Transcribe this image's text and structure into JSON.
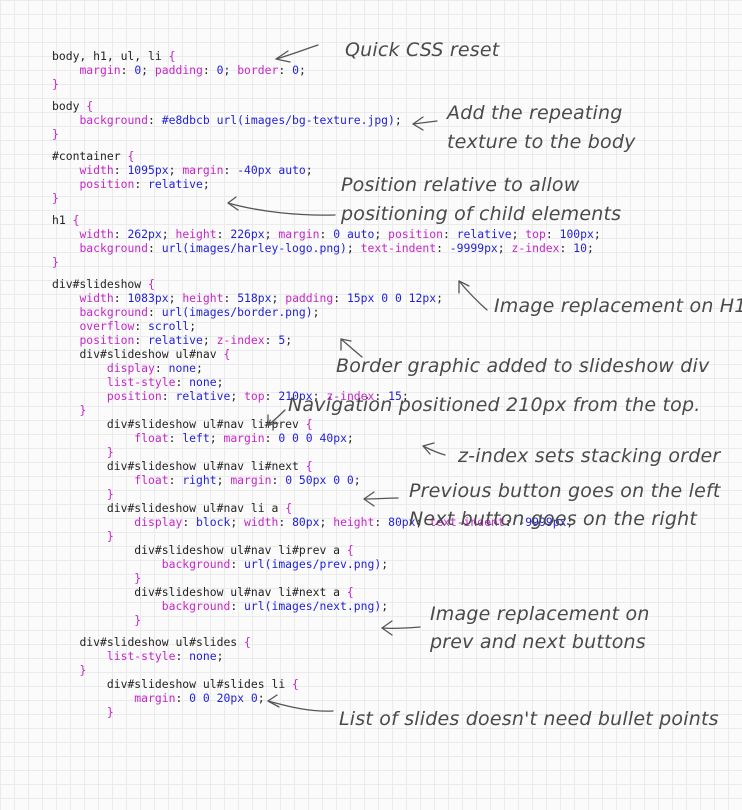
{
  "code_lines": [
    [
      [
        "sel",
        "body, h1, ul, li "
      ],
      [
        "brace",
        "{"
      ]
    ],
    [
      [
        "ind",
        "    "
      ],
      [
        "prop",
        "margin"
      ],
      [
        "sel",
        ": "
      ],
      [
        "val",
        "0"
      ],
      [
        "sel",
        "; "
      ],
      [
        "prop",
        "padding"
      ],
      [
        "sel",
        ": "
      ],
      [
        "val",
        "0"
      ],
      [
        "sel",
        "; "
      ],
      [
        "prop",
        "border"
      ],
      [
        "sel",
        ": "
      ],
      [
        "val",
        "0"
      ],
      [
        "sel",
        ";"
      ]
    ],
    [
      [
        "brace",
        "}"
      ]
    ],
    [],
    [
      [
        "sel",
        "body "
      ],
      [
        "brace",
        "{"
      ]
    ],
    [
      [
        "ind",
        "    "
      ],
      [
        "prop",
        "background"
      ],
      [
        "sel",
        ": "
      ],
      [
        "val",
        "#e8dbcb url(images/bg-texture.jpg)"
      ],
      [
        "sel",
        ";"
      ]
    ],
    [
      [
        "brace",
        "}"
      ]
    ],
    [],
    [
      [
        "sel",
        "#container "
      ],
      [
        "brace",
        "{"
      ]
    ],
    [
      [
        "ind",
        "    "
      ],
      [
        "prop",
        "width"
      ],
      [
        "sel",
        ": "
      ],
      [
        "val",
        "1095px"
      ],
      [
        "sel",
        "; "
      ],
      [
        "prop",
        "margin"
      ],
      [
        "sel",
        ": "
      ],
      [
        "val",
        "-40px auto"
      ],
      [
        "sel",
        ";"
      ]
    ],
    [
      [
        "ind",
        "    "
      ],
      [
        "prop",
        "position"
      ],
      [
        "sel",
        ": "
      ],
      [
        "val",
        "relative"
      ],
      [
        "sel",
        ";"
      ]
    ],
    [
      [
        "brace",
        "}"
      ]
    ],
    [],
    [
      [
        "sel",
        "h1 "
      ],
      [
        "brace",
        "{"
      ]
    ],
    [
      [
        "ind",
        "    "
      ],
      [
        "prop",
        "width"
      ],
      [
        "sel",
        ": "
      ],
      [
        "val",
        "262px"
      ],
      [
        "sel",
        "; "
      ],
      [
        "prop",
        "height"
      ],
      [
        "sel",
        ": "
      ],
      [
        "val",
        "226px"
      ],
      [
        "sel",
        "; "
      ],
      [
        "prop",
        "margin"
      ],
      [
        "sel",
        ": "
      ],
      [
        "val",
        "0 auto"
      ],
      [
        "sel",
        "; "
      ],
      [
        "prop",
        "position"
      ],
      [
        "sel",
        ": "
      ],
      [
        "val",
        "relative"
      ],
      [
        "sel",
        "; "
      ],
      [
        "prop",
        "top"
      ],
      [
        "sel",
        ": "
      ],
      [
        "val",
        "100px"
      ],
      [
        "sel",
        ";"
      ]
    ],
    [
      [
        "ind",
        "    "
      ],
      [
        "prop",
        "background"
      ],
      [
        "sel",
        ": "
      ],
      [
        "val",
        "url(images/harley-logo.png)"
      ],
      [
        "sel",
        "; "
      ],
      [
        "prop",
        "text-indent"
      ],
      [
        "sel",
        ": "
      ],
      [
        "val",
        "-9999px"
      ],
      [
        "sel",
        "; "
      ],
      [
        "prop",
        "z-index"
      ],
      [
        "sel",
        ": "
      ],
      [
        "val",
        "10"
      ],
      [
        "sel",
        ";"
      ]
    ],
    [
      [
        "brace",
        "}"
      ]
    ],
    [],
    [
      [
        "sel",
        "div#slideshow "
      ],
      [
        "brace",
        "{"
      ]
    ],
    [
      [
        "ind",
        "    "
      ],
      [
        "prop",
        "width"
      ],
      [
        "sel",
        ": "
      ],
      [
        "val",
        "1083px"
      ],
      [
        "sel",
        "; "
      ],
      [
        "prop",
        "height"
      ],
      [
        "sel",
        ": "
      ],
      [
        "val",
        "518px"
      ],
      [
        "sel",
        "; "
      ],
      [
        "prop",
        "padding"
      ],
      [
        "sel",
        ": "
      ],
      [
        "val",
        "15px 0 0 12px"
      ],
      [
        "sel",
        ";"
      ]
    ],
    [
      [
        "ind",
        "    "
      ],
      [
        "prop",
        "background"
      ],
      [
        "sel",
        ": "
      ],
      [
        "val",
        "url(images/border.png)"
      ],
      [
        "sel",
        ";"
      ]
    ],
    [
      [
        "ind",
        "    "
      ],
      [
        "prop",
        "overflow"
      ],
      [
        "sel",
        ": "
      ],
      [
        "val",
        "scroll"
      ],
      [
        "sel",
        ";"
      ]
    ],
    [
      [
        "ind",
        "    "
      ],
      [
        "prop",
        "position"
      ],
      [
        "sel",
        ": "
      ],
      [
        "val",
        "relative"
      ],
      [
        "sel",
        "; "
      ],
      [
        "prop",
        "z-index"
      ],
      [
        "sel",
        ": "
      ],
      [
        "val",
        "5"
      ],
      [
        "sel",
        ";"
      ]
    ],
    [
      [
        "ind",
        "    "
      ],
      [
        "sel",
        "div#slideshow ul#nav "
      ],
      [
        "brace",
        "{"
      ]
    ],
    [
      [
        "ind",
        "        "
      ],
      [
        "prop",
        "display"
      ],
      [
        "sel",
        ": "
      ],
      [
        "val",
        "none"
      ],
      [
        "sel",
        ";"
      ]
    ],
    [
      [
        "ind",
        "        "
      ],
      [
        "prop",
        "list-style"
      ],
      [
        "sel",
        ": "
      ],
      [
        "val",
        "none"
      ],
      [
        "sel",
        ";"
      ]
    ],
    [
      [
        "ind",
        "        "
      ],
      [
        "prop",
        "position"
      ],
      [
        "sel",
        ": "
      ],
      [
        "val",
        "relative"
      ],
      [
        "sel",
        "; "
      ],
      [
        "prop",
        "top"
      ],
      [
        "sel",
        ": "
      ],
      [
        "val",
        "210px"
      ],
      [
        "sel",
        "; "
      ],
      [
        "prop",
        "z-index"
      ],
      [
        "sel",
        ": "
      ],
      [
        "val",
        "15"
      ],
      [
        "sel",
        ";"
      ]
    ],
    [
      [
        "ind",
        "    "
      ],
      [
        "brace",
        "}"
      ]
    ],
    [
      [
        "ind",
        "        "
      ],
      [
        "sel",
        "div#slideshow ul#nav li#prev "
      ],
      [
        "brace",
        "{"
      ]
    ],
    [
      [
        "ind",
        "            "
      ],
      [
        "prop",
        "float"
      ],
      [
        "sel",
        ": "
      ],
      [
        "val",
        "left"
      ],
      [
        "sel",
        "; "
      ],
      [
        "prop",
        "margin"
      ],
      [
        "sel",
        ": "
      ],
      [
        "val",
        "0 0 0 40px"
      ],
      [
        "sel",
        ";"
      ]
    ],
    [
      [
        "ind",
        "        "
      ],
      [
        "brace",
        "}"
      ]
    ],
    [
      [
        "ind",
        "        "
      ],
      [
        "sel",
        "div#slideshow ul#nav li#next "
      ],
      [
        "brace",
        "{"
      ]
    ],
    [
      [
        "ind",
        "            "
      ],
      [
        "prop",
        "float"
      ],
      [
        "sel",
        ": "
      ],
      [
        "val",
        "right"
      ],
      [
        "sel",
        "; "
      ],
      [
        "prop",
        "margin"
      ],
      [
        "sel",
        ": "
      ],
      [
        "val",
        "0 50px 0 0"
      ],
      [
        "sel",
        ";"
      ]
    ],
    [
      [
        "ind",
        "        "
      ],
      [
        "brace",
        "}"
      ]
    ],
    [
      [
        "ind",
        "        "
      ],
      [
        "sel",
        "div#slideshow ul#nav li a "
      ],
      [
        "brace",
        "{"
      ]
    ],
    [
      [
        "ind",
        "            "
      ],
      [
        "prop",
        "display"
      ],
      [
        "sel",
        ": "
      ],
      [
        "val",
        "block"
      ],
      [
        "sel",
        "; "
      ],
      [
        "prop",
        "width"
      ],
      [
        "sel",
        ": "
      ],
      [
        "val",
        "80px"
      ],
      [
        "sel",
        "; "
      ],
      [
        "prop",
        "height"
      ],
      [
        "sel",
        ": "
      ],
      [
        "val",
        "80px"
      ],
      [
        "sel",
        "; "
      ],
      [
        "prop",
        "text-indent"
      ],
      [
        "sel",
        ": "
      ],
      [
        "val",
        "-9999px"
      ],
      [
        "sel",
        ";"
      ]
    ],
    [
      [
        "ind",
        "        "
      ],
      [
        "brace",
        "}"
      ]
    ],
    [
      [
        "ind",
        "            "
      ],
      [
        "sel",
        "div#slideshow ul#nav li#prev a "
      ],
      [
        "brace",
        "{"
      ]
    ],
    [
      [
        "ind",
        "                "
      ],
      [
        "prop",
        "background"
      ],
      [
        "sel",
        ": "
      ],
      [
        "val",
        "url(images/prev.png)"
      ],
      [
        "sel",
        ";"
      ]
    ],
    [
      [
        "ind",
        "            "
      ],
      [
        "brace",
        "}"
      ]
    ],
    [
      [
        "ind",
        "            "
      ],
      [
        "sel",
        "div#slideshow ul#nav li#next a "
      ],
      [
        "brace",
        "{"
      ]
    ],
    [
      [
        "ind",
        "                "
      ],
      [
        "prop",
        "background"
      ],
      [
        "sel",
        ": "
      ],
      [
        "val",
        "url(images/next.png)"
      ],
      [
        "sel",
        ";"
      ]
    ],
    [
      [
        "ind",
        "            "
      ],
      [
        "brace",
        "}"
      ]
    ],
    [],
    [
      [
        "ind",
        "    "
      ],
      [
        "sel",
        "div#slideshow ul#slides "
      ],
      [
        "brace",
        "{"
      ]
    ],
    [
      [
        "ind",
        "        "
      ],
      [
        "prop",
        "list-style"
      ],
      [
        "sel",
        ": "
      ],
      [
        "val",
        "none"
      ],
      [
        "sel",
        ";"
      ]
    ],
    [
      [
        "ind",
        "    "
      ],
      [
        "brace",
        "}"
      ]
    ],
    [
      [
        "ind",
        "        "
      ],
      [
        "sel",
        "div#slideshow ul#slides li "
      ],
      [
        "brace",
        "{"
      ]
    ],
    [
      [
        "ind",
        "            "
      ],
      [
        "prop",
        "margin"
      ],
      [
        "sel",
        ": "
      ],
      [
        "val",
        "0 0 20px 0"
      ],
      [
        "sel",
        ";"
      ]
    ],
    [
      [
        "ind",
        "        "
      ],
      [
        "brace",
        "}"
      ]
    ]
  ],
  "annotations": {
    "css_reset": "Quick CSS reset",
    "texture_1": "Add the repeating",
    "texture_2": "texture to the body",
    "position_1": "Position relative to allow",
    "position_2": "positioning of child elements",
    "image_h1": "Image replacement on H1",
    "border": "Border graphic added to slideshow div",
    "navigation": "Navigation positioned 210px from the top.",
    "zindex": "z-index sets stacking order",
    "prev_button": "Previous button goes on the left",
    "next_button": "Next button goes on the right",
    "image_buttons_1": "Image replacement on",
    "image_buttons_2": "prev and next buttons",
    "slides": "List of slides doesn't need bullet points"
  }
}
